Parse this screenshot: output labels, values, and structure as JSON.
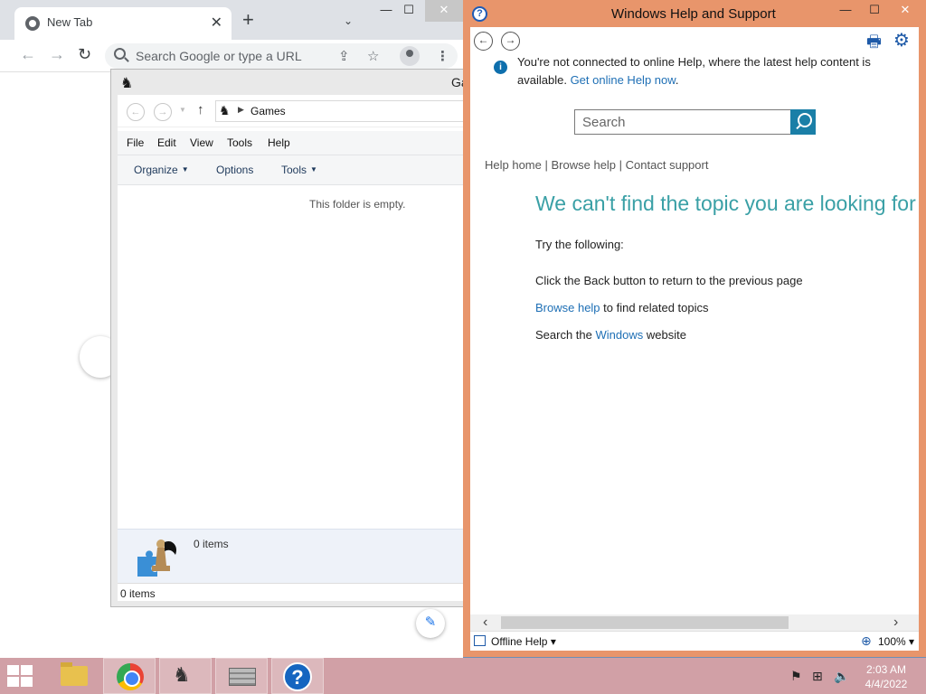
{
  "chrome": {
    "tab_title": "New Tab",
    "tab_close": "✕",
    "new_tab": "+",
    "tab_search": "⌄",
    "omnibox_placeholder": "Search Google or type a URL",
    "back": "←",
    "forward": "→",
    "reload": "↻",
    "share_icon": "⇪",
    "star_icon": "☆",
    "kebab": "⋮",
    "min": "—",
    "max": "☐",
    "close": "✕",
    "edit_icon": "✎"
  },
  "explorer": {
    "title": "Ga",
    "address": "Games",
    "menu": [
      "File",
      "Edit",
      "View",
      "Tools",
      "Help"
    ],
    "commands": [
      "Organize",
      "Options",
      "Tools"
    ],
    "empty_message": "This folder is empty.",
    "details_count": "0 items",
    "status_count": "0 items"
  },
  "help": {
    "title": "Windows Help and Support",
    "min": "—",
    "max": "☐",
    "close": "✕",
    "notice_text": "You're not connected to online Help, where the latest help content is available.",
    "notice_link": "Get online Help now",
    "search_placeholder": "Search",
    "links": [
      "Help home",
      "Browse help",
      "Contact support"
    ],
    "heading": "We can't find the topic you are looking for",
    "try_following": "Try the following:",
    "back_tip": "Click the Back button to return to the previous page",
    "browse_link": "Browse help",
    "browse_rest": " to find related topics",
    "search_prefix": "Search the ",
    "windows_link": "Windows",
    "search_suffix": " website",
    "status_label": "Offline Help",
    "zoom": "100%"
  },
  "taskbar": {
    "time": "2:03 AM",
    "date": "4/4/2022"
  },
  "colors": {
    "help_frame": "#e8956b",
    "help_heading": "#3aa0a6",
    "link": "#1e6fb5",
    "taskbar": "#d1a0a6"
  }
}
